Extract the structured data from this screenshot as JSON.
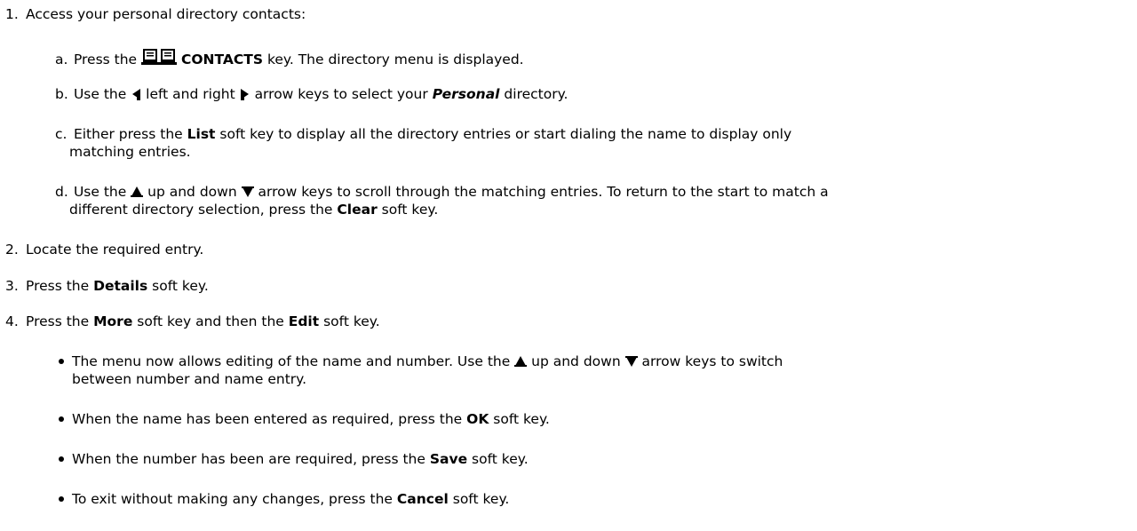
{
  "steps": {
    "s1": {
      "num": "1.",
      "text": "Access your personal directory contacts:"
    },
    "a": {
      "letter": "a.",
      "t1": "Press the",
      "key": "CONTACTS",
      "t2": "key. The directory menu is displayed.",
      "icon": "book-icon"
    },
    "b": {
      "letter": "b.",
      "t1": "Use the",
      "t2": "left and right",
      "t3": "arrow keys to select your",
      "term": "Personal",
      "t4": "directory.",
      "icon_left": "left-arrow-icon",
      "icon_right": "right-arrow-icon"
    },
    "c": {
      "letter": "c.",
      "t1": "Either press the",
      "key": "List",
      "t2": "soft key to display all the directory entries or start dialing the name to display only",
      "t3": "matching entries."
    },
    "d": {
      "letter": "d.",
      "t1": "Use the",
      "t2": "up and down",
      "t3": "arrow keys to scroll through the matching entries. To return to the start to match a",
      "t4": "different directory selection, press the",
      "key": "Clear",
      "t5": "soft key.",
      "icon_up": "up-arrow-icon",
      "icon_down": "down-arrow-icon"
    },
    "s2": {
      "num": "2.",
      "text": "Locate the required entry."
    },
    "s3": {
      "num": "3.",
      "t1": "Press the",
      "key": "Details",
      "t2": "soft key."
    },
    "s4": {
      "num": "4.",
      "t1": "Press the",
      "key1": "More",
      "t2": "soft key and then the",
      "key2": "Edit",
      "t3": "soft key."
    }
  },
  "bullets": {
    "b1": {
      "t1": "The menu now allows editing of the name and number. Use the",
      "t2": "up and down",
      "t3": "arrow keys to switch",
      "t4": "between number and name entry."
    },
    "b2": {
      "t1": "When the name has been entered as required, press the",
      "key": "OK",
      "t2": "soft key."
    },
    "b3": {
      "t1": "When the number has been are required, press the",
      "key": "Save",
      "t2": "soft key."
    },
    "b4": {
      "t1": "To exit without making any changes, press the",
      "key": "Cancel",
      "t2": "soft key."
    }
  }
}
